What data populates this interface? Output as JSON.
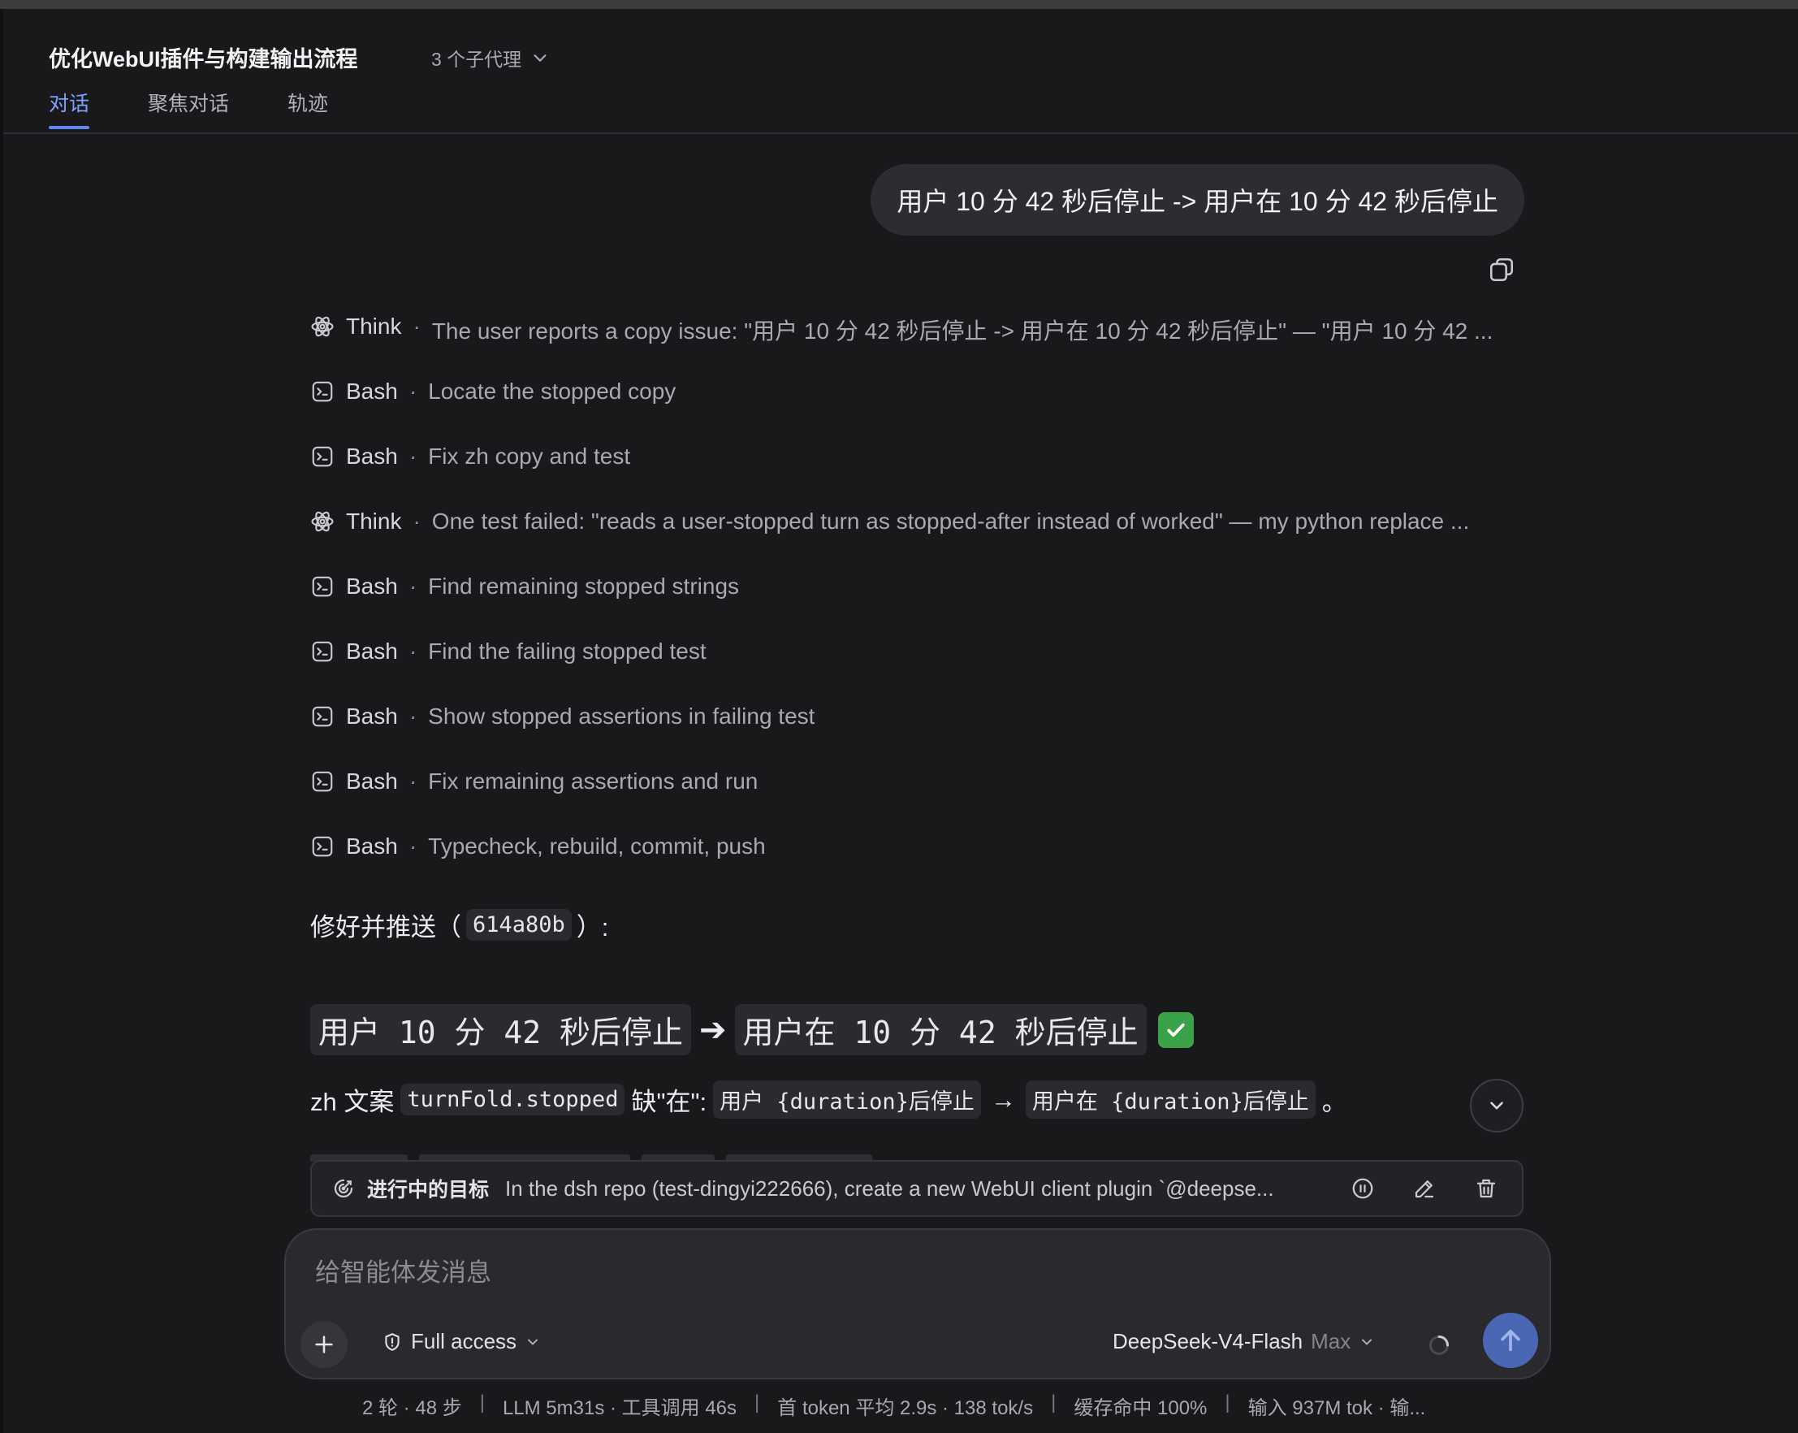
{
  "header": {
    "title": "优化WebUI插件与构建输出流程",
    "agents_label": "3 个子代理",
    "tabs": [
      {
        "label": "对话",
        "active": true
      },
      {
        "label": "聚焦对话",
        "active": false
      },
      {
        "label": "轨迹",
        "active": false
      }
    ]
  },
  "user_message": "用户 10 分 42 秒后停止 -> 用户在 10 分 42 秒后停止",
  "steps": [
    {
      "kind": "Think",
      "icon": "brain-icon",
      "text": "The user reports a copy issue: \"用户 10 分 42 秒后停止 -> 用户在 10 分 42 秒后停止\" — \"用户 10 分 42 ..."
    },
    {
      "kind": "Bash",
      "icon": "terminal-icon",
      "text": "Locate the stopped copy"
    },
    {
      "kind": "Bash",
      "icon": "terminal-icon",
      "text": "Fix zh copy and test"
    },
    {
      "kind": "Think",
      "icon": "brain-icon",
      "text": "One test failed: \"reads a user-stopped turn as stopped-after instead of worked\" — my python replace ..."
    },
    {
      "kind": "Bash",
      "icon": "terminal-icon",
      "text": "Find remaining stopped strings"
    },
    {
      "kind": "Bash",
      "icon": "terminal-icon",
      "text": "Find the failing stopped test"
    },
    {
      "kind": "Bash",
      "icon": "terminal-icon",
      "text": "Show stopped assertions in failing test"
    },
    {
      "kind": "Bash",
      "icon": "terminal-icon",
      "text": "Fix remaining assertions and run"
    },
    {
      "kind": "Bash",
      "icon": "terminal-icon",
      "text": "Typecheck, rebuild, commit, push"
    }
  ],
  "step_separator": "·",
  "response": {
    "fixed_prefix": "修好并推送（",
    "commit": "614a80b",
    "fixed_suffix": "）:",
    "heading_before": "用户 10 分 42 秒后停止",
    "heading_arrow": "➔",
    "heading_after": "用户在 10 分 42 秒后停止",
    "detail_prefix": "zh 文案",
    "detail_key": "turnFold.stopped",
    "detail_mid": "缺\"在\":",
    "detail_before": "用户 {duration}后停止",
    "detail_arrow": "→",
    "detail_after": "用户在 {duration}后停止",
    "detail_end": "。"
  },
  "goal": {
    "label": "进行中的目标",
    "text": "In the dsh repo (test-dingyi222666), create a new WebUI client plugin `@deepse..."
  },
  "composer": {
    "placeholder": "给智能体发消息",
    "access_label": "Full access",
    "model_name": "DeepSeek-V4-Flash",
    "model_tier": "Max"
  },
  "status": [
    "2 轮 · 48 步",
    "LLM 5m31s · 工具调用 46s",
    "首 token 平均 2.9s · 138 tok/s",
    "缓存命中 100%",
    "输入 937M tok · 输..."
  ],
  "colors": {
    "background": "#19191c",
    "accent": "#7ea2ff",
    "send_button": "#4a67b3",
    "success": "#3aa34a"
  }
}
